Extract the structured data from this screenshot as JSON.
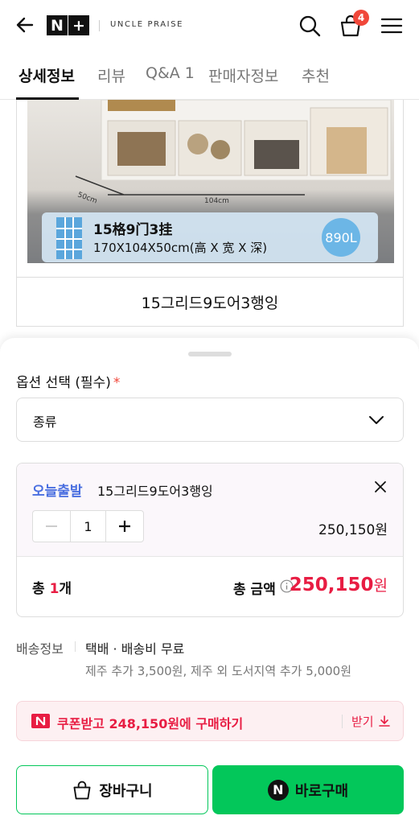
{
  "header": {
    "logo_letters": [
      "N",
      "+"
    ],
    "brand": "UNCLE PRAISE",
    "cart_count": "4"
  },
  "tabs": [
    {
      "label": "상세정보",
      "active": true
    },
    {
      "label": "리뷰"
    },
    {
      "label": "Q&A 1"
    },
    {
      "label": "판매자정보"
    },
    {
      "label": "추천"
    }
  ],
  "product": {
    "image_title": "15格9门3挂",
    "image_dims": "170X104X50cm(高 X 宽 X 深)",
    "image_volume": "890L",
    "image_measure_depth": "50cm",
    "image_measure_width": "104cm",
    "caption": "15그리드9도어3행잉"
  },
  "sheet": {
    "option_title": "옵션 선택 (필수)",
    "required_mark": "*",
    "select_value": "종류",
    "chosen": {
      "badge": "오늘출발",
      "name": "15그리드9도어3행잉",
      "quantity": "1",
      "price": "250,150원"
    },
    "total": {
      "count_prefix": "총 ",
      "count": "1",
      "count_suffix": "개",
      "label": "총 금액",
      "amount": "250,150",
      "currency": "원"
    },
    "shipping": {
      "label": "배송정보",
      "value": "택배 · 배송비 무료",
      "extra": "제주 추가 3,500원, 제주 외 도서지역 추가 5,000원"
    },
    "coupon": {
      "text": "쿠폰받고 248,150원에 구매하기",
      "action": "받기"
    },
    "buttons": {
      "cart": "장바구니",
      "buy": "바로구매"
    }
  },
  "colors": {
    "accent_green": "#03c75a",
    "price_red": "#e81d43",
    "today_blue": "#4a6fe0",
    "badge_red": "#f0473a"
  },
  "icons": [
    "back-arrow-icon",
    "search-icon",
    "cart-bag-icon",
    "hamburger-menu-icon",
    "chevron-down-icon",
    "close-icon",
    "minus-icon",
    "plus-icon",
    "info-icon",
    "naver-n-icon",
    "download-icon"
  ]
}
